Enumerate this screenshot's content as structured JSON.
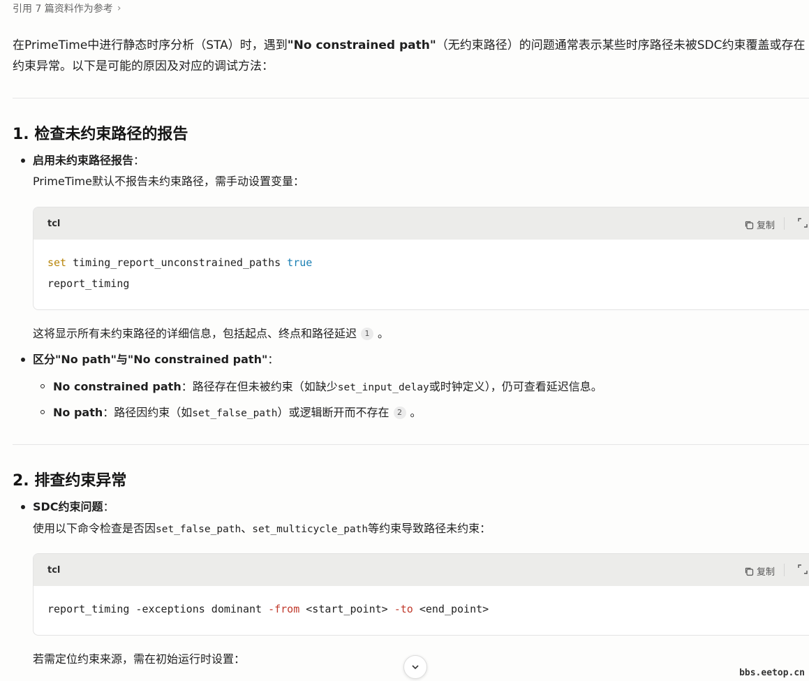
{
  "citation": {
    "label": "引用 7 篇资料作为参考",
    "chevron": "›"
  },
  "intro": {
    "before": "在PrimeTime中进行静态时序分析（STA）时，遇到",
    "bold": "\"No constrained path\"",
    "after": "（无约束路径）的问题通常表示某些时序路径未被SDC约束覆盖或存在约束异常。以下是可能的原因及对应的调试方法："
  },
  "section1": {
    "title": "1. 检查未约束路径的报告",
    "bullet1": {
      "title": "启用未约束路径报告",
      "colon": "：",
      "desc": "PrimeTime默认不报告未约束路径，需手动设置变量："
    },
    "code1": {
      "lang": "tcl",
      "copy_label": "复制",
      "line1_kw": "set",
      "line1_mid": " timing_report_unconstrained_paths ",
      "line1_bool": "true",
      "line2": "report_timing"
    },
    "after_code": "这将显示所有未约束路径的详细信息，包括起点、终点和路径延迟",
    "after_code_ref": "1",
    "after_code_end": "。",
    "bullet2": {
      "title": "区分\"No path\"与\"No constrained path\"",
      "colon": "："
    },
    "sub1": {
      "title": "No constrained path",
      "t1": "：路径存在但未被约束（如缺少",
      "code": "set_input_delay",
      "t2": "或时钟定义），仍可查看延迟信息。"
    },
    "sub2": {
      "title": "No path",
      "t1": "：路径因约束（如",
      "code": "set_false_path",
      "t2": "）或逻辑断开而不存在",
      "ref": "2",
      "end": "。"
    }
  },
  "section2": {
    "title": "2. 排查约束异常",
    "bullet1": {
      "title": "SDC约束问题",
      "colon": "：",
      "d1": "使用以下命令检查是否因",
      "c1": "set_false_path",
      "d2": "、",
      "c2": "set_multicycle_path",
      "d3": "等约束导致路径未约束："
    },
    "code2": {
      "lang": "tcl",
      "copy_label": "复制",
      "p1": "report_timing -exceptions dominant ",
      "o1": "-from",
      "p2": " <start_point> ",
      "o2": "-to",
      "p3": " <end_point>"
    },
    "after_code": "若需定位约束来源，需在初始运行时设置："
  },
  "watermark": "bbs.eetop.cn",
  "colors": {
    "keyword": "#b8860b",
    "boolean": "#1a7fb3",
    "option": "#c0392b"
  }
}
